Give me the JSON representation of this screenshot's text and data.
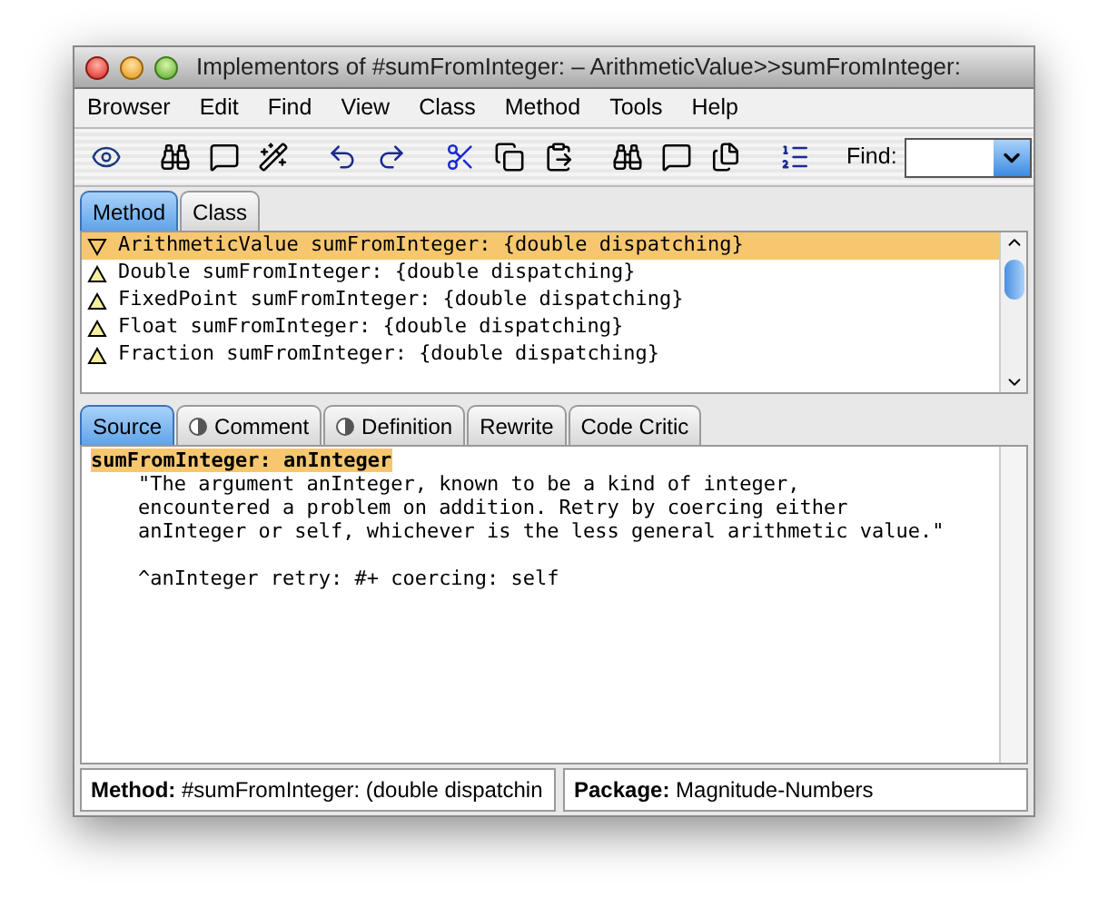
{
  "window": {
    "title": "Implementors of #sumFromInteger: – ArithmeticValue>>sumFromInteger:"
  },
  "menu": [
    "Browser",
    "Edit",
    "Find",
    "View",
    "Class",
    "Method",
    "Tools",
    "Help"
  ],
  "toolbar": {
    "find_label": "Find:"
  },
  "top_tabs": [
    {
      "label": "Method",
      "selected": true
    },
    {
      "label": "Class",
      "selected": false
    }
  ],
  "methods": [
    {
      "text": "ArithmeticValue sumFromInteger: {double dispatching}",
      "selected": true
    },
    {
      "text": "Double sumFromInteger: {double dispatching}",
      "selected": false
    },
    {
      "text": "FixedPoint sumFromInteger: {double dispatching}",
      "selected": false
    },
    {
      "text": "Float sumFromInteger: {double dispatching}",
      "selected": false
    },
    {
      "text": "Fraction sumFromInteger: {double dispatching}",
      "selected": false
    }
  ],
  "code_tabs": [
    {
      "label": "Source",
      "selected": true,
      "marked": false
    },
    {
      "label": "Comment",
      "selected": false,
      "marked": true
    },
    {
      "label": "Definition",
      "selected": false,
      "marked": true
    },
    {
      "label": "Rewrite",
      "selected": false,
      "marked": false
    },
    {
      "label": "Code Critic",
      "selected": false,
      "marked": false
    }
  ],
  "source": [
    {
      "kind": "selector",
      "text": "sumFromInteger: anInteger"
    },
    {
      "kind": "comment",
      "text": "\"The argument anInteger, known to be a kind of integer,"
    },
    {
      "kind": "comment",
      "text": "encountered a problem on addition. Retry by coercing either"
    },
    {
      "kind": "comment",
      "text": "anInteger or self, whichever is the less general arithmetic value.\""
    },
    {
      "kind": "statement",
      "text": "^anInteger retry: #+ coercing: self"
    }
  ],
  "status_bar": [
    "**Method:** #sumFromInteger: (double dispatchin",
    "**Package:** Magnitude-Numbers"
  ]
}
